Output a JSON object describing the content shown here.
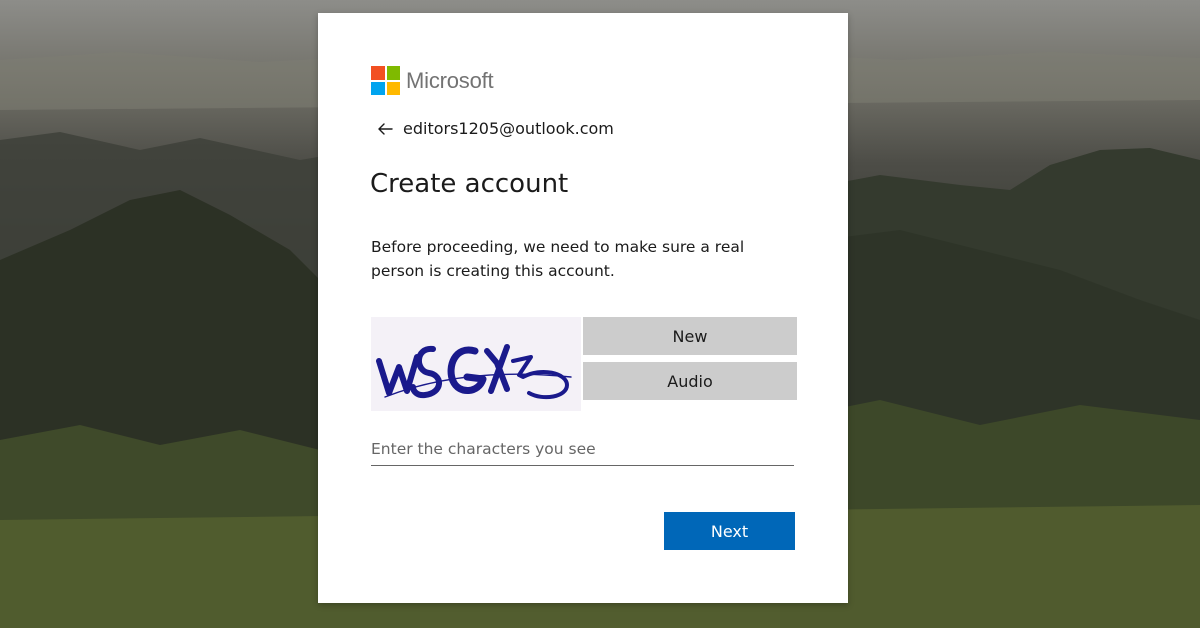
{
  "brand": {
    "name": "Microsoft",
    "logo_colors": [
      "#f25022",
      "#7fba00",
      "#00a4ef",
      "#ffb900"
    ]
  },
  "identity": {
    "back_icon": "arrow-left-icon",
    "email": "editors1205@outlook.com"
  },
  "title": "Create account",
  "description": "Before proceeding, we need to make sure a real person is creating this account.",
  "captcha": {
    "new_label": "New",
    "audio_label": "Audio",
    "input_placeholder": "Enter the characters you see",
    "input_value": ""
  },
  "next_label": "Next",
  "colors": {
    "primary": "#0067b8",
    "captcha_button": "#cccccc",
    "text": "#1b1b1b",
    "captcha_ink": "#1a1a8c"
  }
}
